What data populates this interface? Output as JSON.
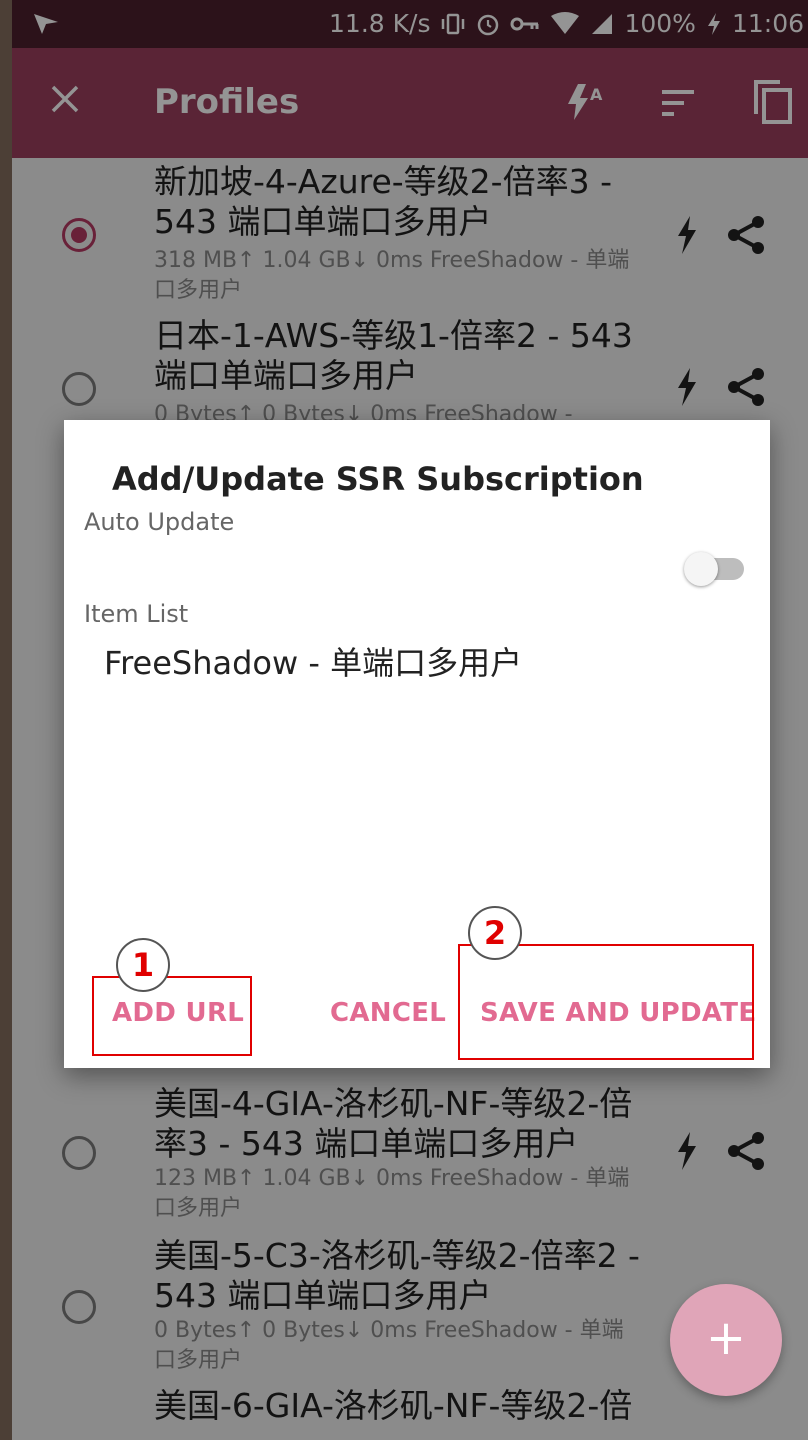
{
  "status_bar": {
    "speed": "11.8 K/s",
    "battery": "100%",
    "time": "11:06"
  },
  "toolbar": {
    "title": "Profiles"
  },
  "profiles": [
    {
      "name": "新加坡-4-Azure-等级2-倍率3 - 543 端口单端口多用户",
      "stats": "318 MB↑ 1.04 GB↓ 0ms FreeShadow - 单端口多用户",
      "selected": true
    },
    {
      "name": "日本-1-AWS-等级1-倍率2 - 543 端口单端口多用户",
      "stats": "0 Bytes↑ 0 Bytes↓ 0ms FreeShadow -",
      "selected": false
    },
    {
      "name": "美国-4-GIA-洛杉矶-NF-等级2-倍率3 - 543 端口单端口多用户",
      "stats": "123 MB↑ 1.04 GB↓ 0ms FreeShadow - 单端口多用户",
      "selected": false
    },
    {
      "name": "美国-5-C3-洛杉矶-等级2-倍率2 - 543 端口单端口多用户",
      "stats": "0 Bytes↑ 0 Bytes↓ 0ms FreeShadow - 单端口多用户",
      "selected": false
    },
    {
      "name": "美国-6-GIA-洛杉矶-NF-等级2-倍",
      "stats": "",
      "selected": false
    }
  ],
  "dialog": {
    "title": "Add/Update SSR Subscription",
    "auto_update_label": "Auto Update",
    "auto_update_on": false,
    "item_list_label": "Item List",
    "items": [
      "FreeShadow - 单端口多用户"
    ],
    "add_url": "ADD URL",
    "cancel": "CANCEL",
    "save_update": "SAVE AND UPDATE"
  },
  "annotations": [
    "1",
    "2"
  ],
  "fab_label": "+",
  "colors": {
    "primary": "#9c3e5e",
    "status_bar": "#4d1f2d",
    "accent": "#e26a91",
    "annotation": "#e00000"
  }
}
